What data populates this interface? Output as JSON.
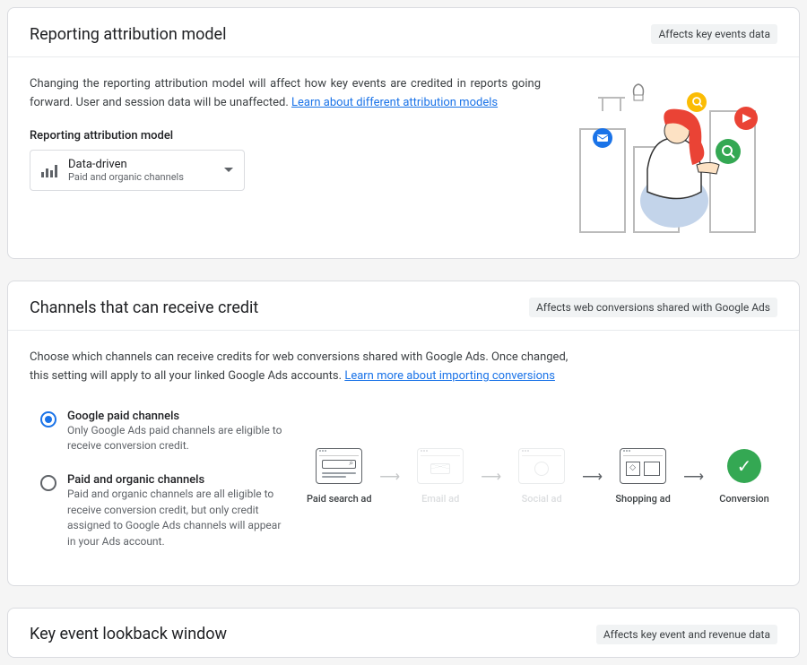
{
  "card1": {
    "title": "Reporting attribution model",
    "badge": "Affects key events data",
    "desc": "Changing the reporting attribution model will affect how key events are credited in reports going forward. User and session data will be unaffected.",
    "link": "Learn about different attribution models",
    "label": "Reporting attribution model",
    "dropdown": {
      "title": "Data-driven",
      "sub": "Paid and organic channels"
    }
  },
  "card2": {
    "title": "Channels that can receive credit",
    "badge": "Affects web conversions shared with Google Ads",
    "desc": "Choose which channels can receive credits for web conversions shared with Google Ads. Once changed, this setting will apply to all your linked Google Ads accounts.",
    "link": "Learn more about importing conversions",
    "opt1": {
      "title": "Google paid channels",
      "desc": "Only Google Ads paid channels are eligible to receive conversion credit."
    },
    "opt2": {
      "title": "Paid and organic channels",
      "desc": "Paid and organic channels are all eligible to receive conversion credit, but only credit assigned to Google Ads channels will appear in your Ads account."
    },
    "flow": {
      "paid_search": "Paid search ad",
      "email": "Email ad",
      "social": "Social ad",
      "shopping": "Shopping ad",
      "conversion": "Conversion"
    }
  },
  "card3": {
    "title": "Key event lookback window",
    "badge": "Affects key event and revenue data"
  }
}
